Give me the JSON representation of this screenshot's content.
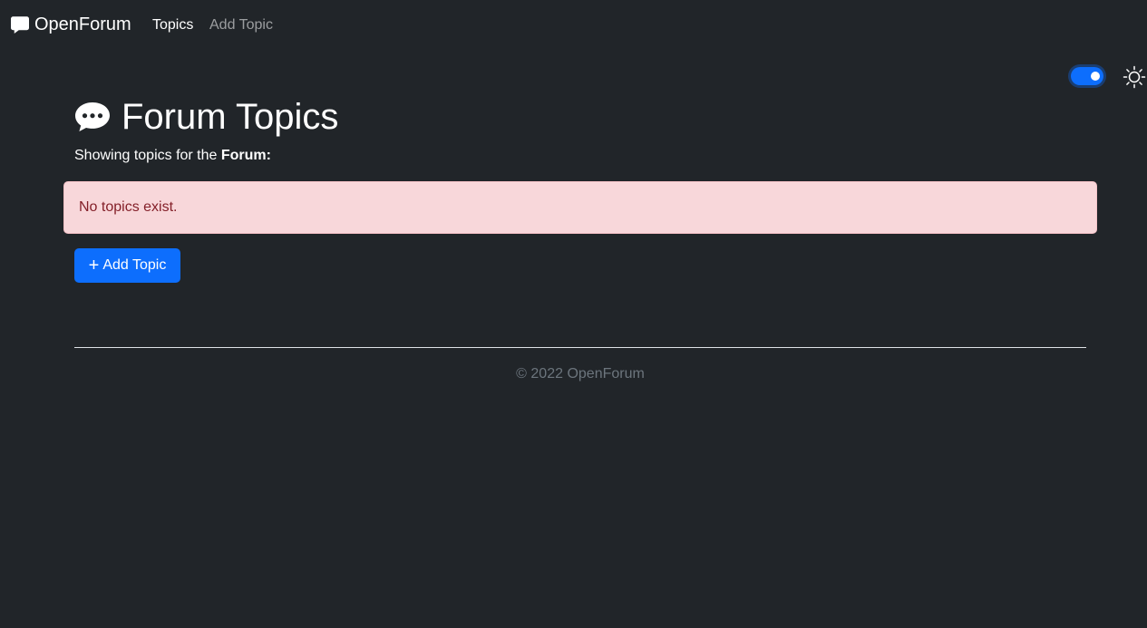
{
  "navbar": {
    "brand": "OpenForum",
    "brand_icon": "chat-square-icon",
    "links": [
      {
        "label": "Topics",
        "active": true
      },
      {
        "label": "Add Topic",
        "active": false
      }
    ]
  },
  "theme": {
    "toggle_on": true,
    "icon": "sun-icon",
    "accent": "#0d6efd"
  },
  "main": {
    "title": "Forum Topics",
    "title_icon": "chat-dots-icon",
    "subtitle_prefix": "Showing topics for the ",
    "subtitle_bold": "Forum:",
    "alert_text": "No topics exist.",
    "add_button_label": "Add Topic"
  },
  "footer": {
    "text": "© 2022 OpenForum"
  }
}
